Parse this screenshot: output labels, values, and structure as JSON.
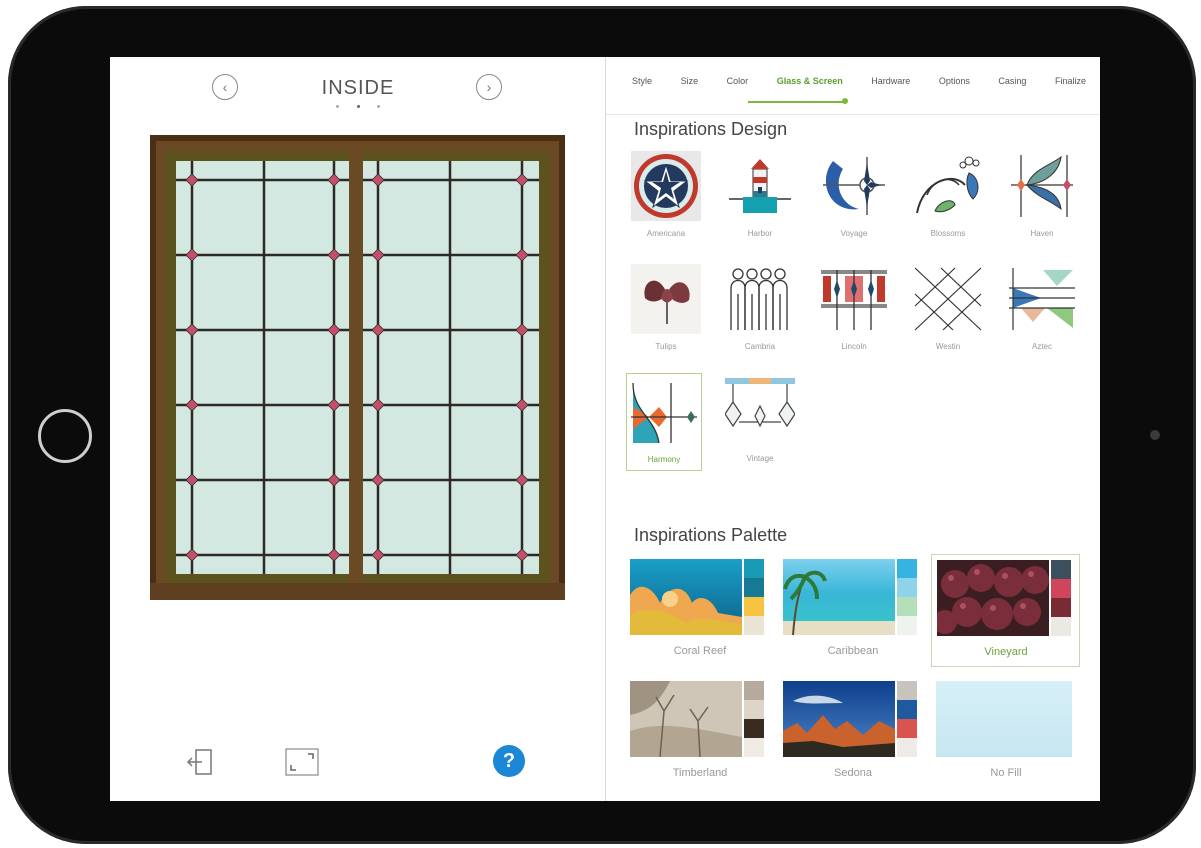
{
  "left_panel": {
    "view_title": "INSIDE"
  },
  "tabs": [
    {
      "label": "Style"
    },
    {
      "label": "Size"
    },
    {
      "label": "Color"
    },
    {
      "label": "Glass & Screen",
      "active": true
    },
    {
      "label": "Hardware"
    },
    {
      "label": "Options"
    },
    {
      "label": "Casing"
    },
    {
      "label": "Finalize"
    }
  ],
  "designs_section": {
    "title": "Inspirations Design",
    "items": [
      {
        "label": "Americana",
        "icon": "americana-icon"
      },
      {
        "label": "Harbor",
        "icon": "harbor-icon"
      },
      {
        "label": "Voyage",
        "icon": "voyage-icon"
      },
      {
        "label": "Blossoms",
        "icon": "blossoms-icon"
      },
      {
        "label": "Haven",
        "icon": "haven-icon"
      },
      {
        "label": "Tulips",
        "icon": "tulips-icon"
      },
      {
        "label": "Cambria",
        "icon": "cambria-icon"
      },
      {
        "label": "Lincoln",
        "icon": "lincoln-icon"
      },
      {
        "label": "Westin",
        "icon": "westin-icon"
      },
      {
        "label": "Aztec",
        "icon": "aztec-icon"
      },
      {
        "label": "Harmony",
        "icon": "harmony-icon",
        "selected": true
      },
      {
        "label": "Vintage",
        "icon": "vintage-icon"
      }
    ]
  },
  "palette_section": {
    "title": "Inspirations Palette",
    "items": [
      {
        "label": "Coral Reef",
        "swatches": [
          "#1a9bb5",
          "#167a94",
          "#f5c242",
          "#e9e4d4"
        ]
      },
      {
        "label": "Caribbean",
        "swatches": [
          "#36b3e0",
          "#8fd3e8",
          "#b4dfb9",
          "#eef3ee"
        ]
      },
      {
        "label": "Vineyard",
        "selected": true,
        "swatches": [
          "#3d4f5c",
          "#d0455a",
          "#7a2a35",
          "#ece9e4"
        ]
      },
      {
        "label": "Timberland",
        "swatches": [
          "#b5aa9c",
          "#ddd5c9",
          "#3b2a1f",
          "#efebe4"
        ]
      },
      {
        "label": "Sedona",
        "swatches": [
          "#c9c3bd",
          "#1f5aa0",
          "#d9534f",
          "#eeeae6"
        ]
      },
      {
        "label": "No Fill",
        "swatches": []
      }
    ]
  },
  "colors": {
    "accent": "#7fb63c",
    "help": "#1b87d6",
    "frame": "#5a3a1e",
    "glass": "#d4e8e2",
    "jewel": "#c2506a"
  }
}
